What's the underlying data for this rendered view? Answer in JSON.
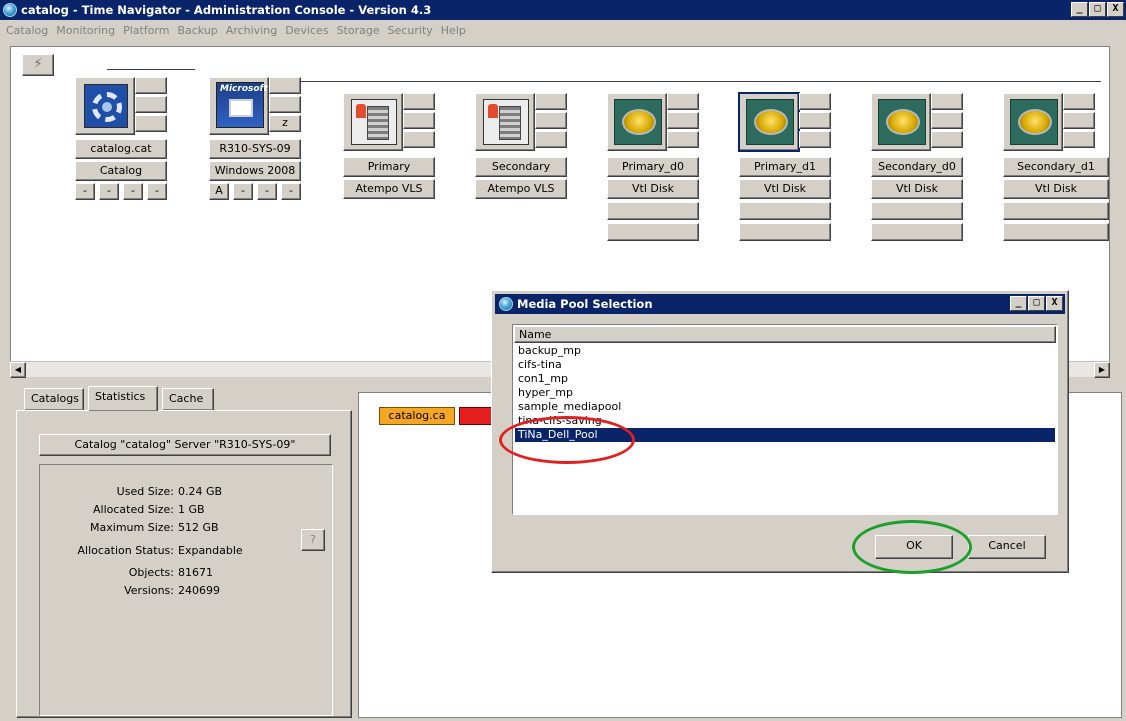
{
  "window": {
    "title": "catalog - Time Navigator - Administration Console - Version 4.3",
    "controls": [
      "_",
      "□",
      "X"
    ]
  },
  "menu": [
    "Catalog",
    "Monitoring",
    "Platform",
    "Backup",
    "Archiving",
    "Devices",
    "Storage",
    "Security",
    "Help"
  ],
  "nodes": [
    {
      "icon": "catalog-icon",
      "rows": [
        "catalog.cat",
        "Catalog"
      ],
      "dashes": [
        "-",
        "-",
        "-",
        "-"
      ]
    },
    {
      "icon": "microsoft-host-icon",
      "icon_text": "Microsoft",
      "side_badge": "z",
      "rows": [
        "R310-SYS-09",
        "Windows 2008"
      ],
      "dashes": [
        "A",
        "-",
        "-",
        "-"
      ]
    },
    {
      "icon": "library-icon",
      "rows": [
        "Primary",
        "Atempo VLS"
      ]
    },
    {
      "icon": "library-icon",
      "rows": [
        "Secondary",
        "Atempo VLS"
      ]
    },
    {
      "icon": "disk-icon",
      "rows": [
        "Primary_d0",
        "Vtl Disk"
      ]
    },
    {
      "icon": "disk-icon",
      "rows": [
        "Primary_d1",
        "Vtl Disk"
      ],
      "selected": true
    },
    {
      "icon": "disk-icon",
      "rows": [
        "Secondary_d0",
        "Vtl Disk"
      ]
    },
    {
      "icon": "disk-icon",
      "rows": [
        "Secondary_d1",
        "Vtl Disk"
      ]
    }
  ],
  "tabs": [
    "Catalogs",
    "Statistics",
    "Cache"
  ],
  "active_tab": "Statistics",
  "catalog_header": "Catalog \"catalog\" Server \"R310-SYS-09\"",
  "stats": [
    {
      "label": "Used Size:",
      "value": "0.24 GB"
    },
    {
      "label": "Allocated Size:",
      "value": "1 GB"
    },
    {
      "label": "Maximum Size:",
      "value": "512 GB"
    },
    {
      "label": "Allocation Status:",
      "value": "Expandable"
    },
    {
      "label": "Objects:",
      "value": "81671"
    },
    {
      "label": "Versions:",
      "value": "240699"
    }
  ],
  "help_label": "?",
  "right_chip": "catalog.ca",
  "dialog": {
    "title": "Media Pool Selection",
    "column": "Name",
    "items": [
      "backup_mp",
      "cifs-tina",
      "con1_mp",
      "hyper_mp",
      "sample_mediapool",
      "tina-cifs-saving",
      "TiNa_Dell_Pool"
    ],
    "selected": "TiNa_Dell_Pool",
    "ok": "OK",
    "cancel": "Cancel"
  },
  "colors": {
    "titlebar": "#0a246a",
    "selection": "#0a246a",
    "annotation_red": "#e02020",
    "annotation_green": "#1ca02c"
  }
}
